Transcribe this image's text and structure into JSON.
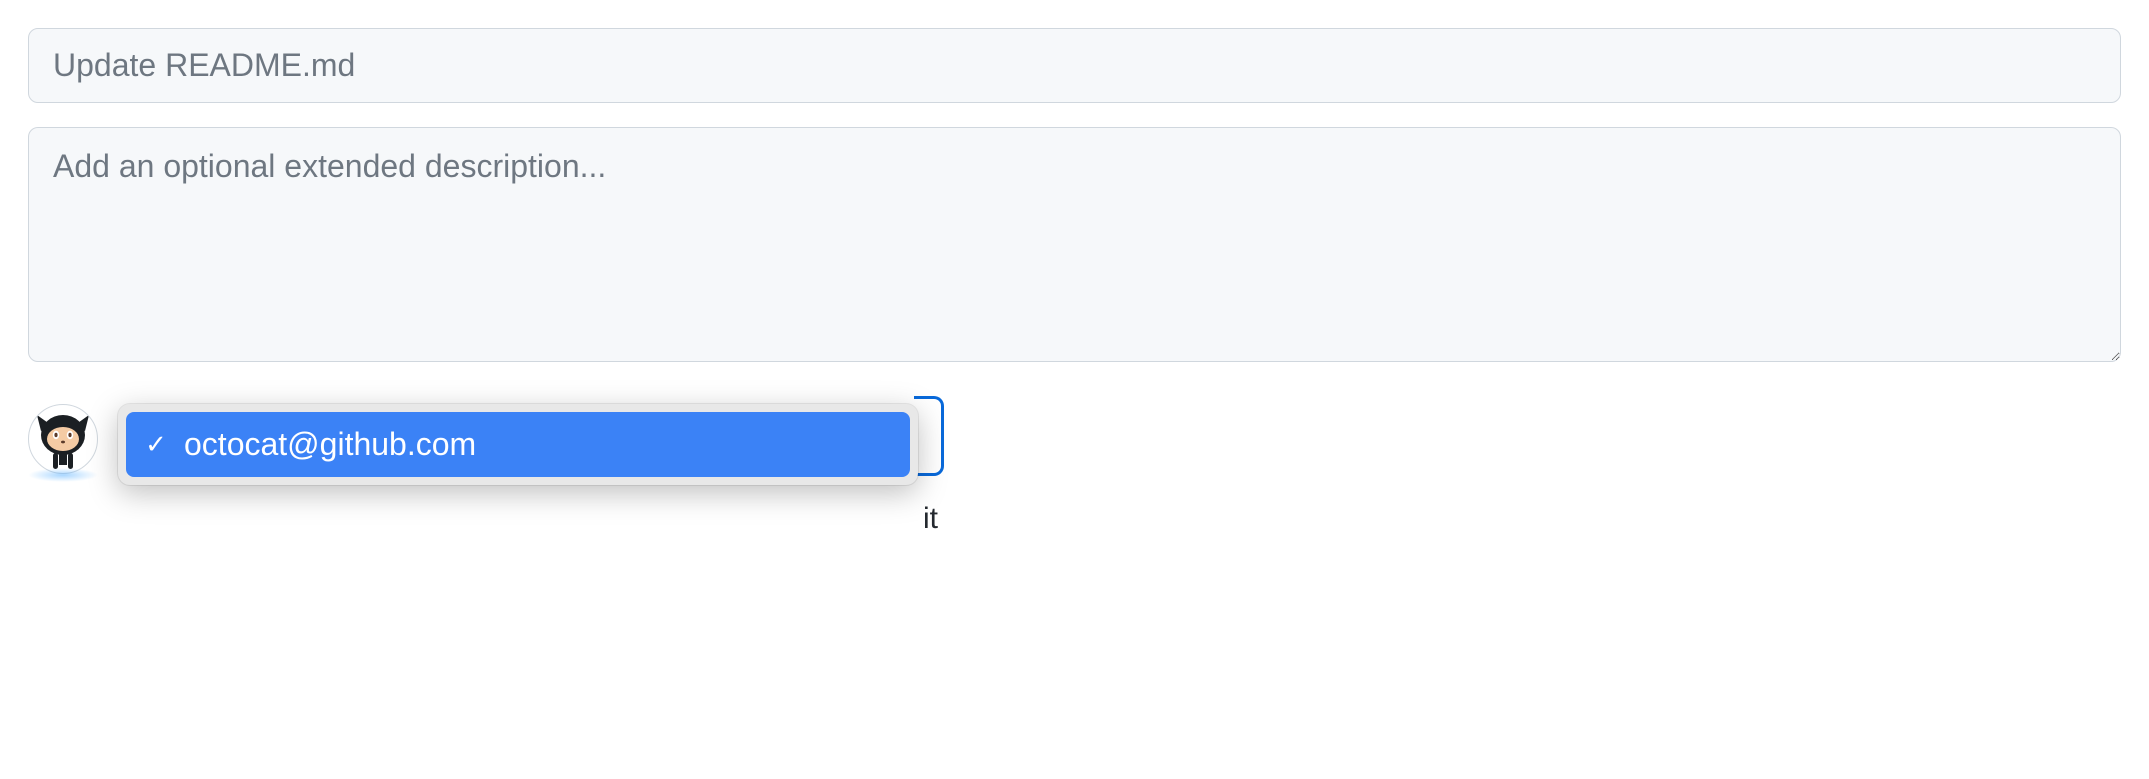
{
  "commit": {
    "summary_placeholder": "Update README.md",
    "summary_value": "",
    "description_placeholder": "Add an optional extended description...",
    "description_value": ""
  },
  "author_dropdown": {
    "selected": "octocat@github.com",
    "options": [
      {
        "label": "octocat@github.com",
        "checked": true
      }
    ]
  },
  "trailing_fragment": "it",
  "icons": {
    "check": "✓"
  }
}
